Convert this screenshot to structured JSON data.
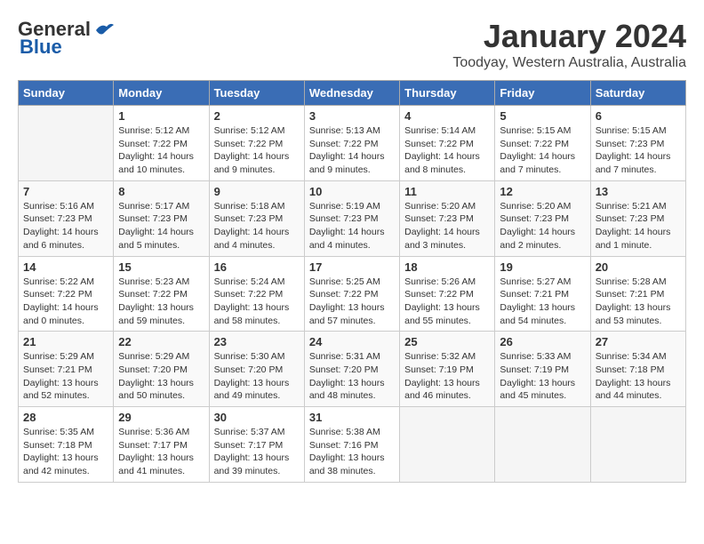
{
  "header": {
    "logo_line1": "General",
    "logo_line2": "Blue",
    "month": "January 2024",
    "location": "Toodyay, Western Australia, Australia"
  },
  "weekdays": [
    "Sunday",
    "Monday",
    "Tuesday",
    "Wednesday",
    "Thursday",
    "Friday",
    "Saturday"
  ],
  "weeks": [
    [
      {
        "day": "",
        "content": ""
      },
      {
        "day": "1",
        "content": "Sunrise: 5:12 AM\nSunset: 7:22 PM\nDaylight: 14 hours\nand 10 minutes."
      },
      {
        "day": "2",
        "content": "Sunrise: 5:12 AM\nSunset: 7:22 PM\nDaylight: 14 hours\nand 9 minutes."
      },
      {
        "day": "3",
        "content": "Sunrise: 5:13 AM\nSunset: 7:22 PM\nDaylight: 14 hours\nand 9 minutes."
      },
      {
        "day": "4",
        "content": "Sunrise: 5:14 AM\nSunset: 7:22 PM\nDaylight: 14 hours\nand 8 minutes."
      },
      {
        "day": "5",
        "content": "Sunrise: 5:15 AM\nSunset: 7:22 PM\nDaylight: 14 hours\nand 7 minutes."
      },
      {
        "day": "6",
        "content": "Sunrise: 5:15 AM\nSunset: 7:23 PM\nDaylight: 14 hours\nand 7 minutes."
      }
    ],
    [
      {
        "day": "7",
        "content": "Sunrise: 5:16 AM\nSunset: 7:23 PM\nDaylight: 14 hours\nand 6 minutes."
      },
      {
        "day": "8",
        "content": "Sunrise: 5:17 AM\nSunset: 7:23 PM\nDaylight: 14 hours\nand 5 minutes."
      },
      {
        "day": "9",
        "content": "Sunrise: 5:18 AM\nSunset: 7:23 PM\nDaylight: 14 hours\nand 4 minutes."
      },
      {
        "day": "10",
        "content": "Sunrise: 5:19 AM\nSunset: 7:23 PM\nDaylight: 14 hours\nand 4 minutes."
      },
      {
        "day": "11",
        "content": "Sunrise: 5:20 AM\nSunset: 7:23 PM\nDaylight: 14 hours\nand 3 minutes."
      },
      {
        "day": "12",
        "content": "Sunrise: 5:20 AM\nSunset: 7:23 PM\nDaylight: 14 hours\nand 2 minutes."
      },
      {
        "day": "13",
        "content": "Sunrise: 5:21 AM\nSunset: 7:23 PM\nDaylight: 14 hours\nand 1 minute."
      }
    ],
    [
      {
        "day": "14",
        "content": "Sunrise: 5:22 AM\nSunset: 7:22 PM\nDaylight: 14 hours\nand 0 minutes."
      },
      {
        "day": "15",
        "content": "Sunrise: 5:23 AM\nSunset: 7:22 PM\nDaylight: 13 hours\nand 59 minutes."
      },
      {
        "day": "16",
        "content": "Sunrise: 5:24 AM\nSunset: 7:22 PM\nDaylight: 13 hours\nand 58 minutes."
      },
      {
        "day": "17",
        "content": "Sunrise: 5:25 AM\nSunset: 7:22 PM\nDaylight: 13 hours\nand 57 minutes."
      },
      {
        "day": "18",
        "content": "Sunrise: 5:26 AM\nSunset: 7:22 PM\nDaylight: 13 hours\nand 55 minutes."
      },
      {
        "day": "19",
        "content": "Sunrise: 5:27 AM\nSunset: 7:21 PM\nDaylight: 13 hours\nand 54 minutes."
      },
      {
        "day": "20",
        "content": "Sunrise: 5:28 AM\nSunset: 7:21 PM\nDaylight: 13 hours\nand 53 minutes."
      }
    ],
    [
      {
        "day": "21",
        "content": "Sunrise: 5:29 AM\nSunset: 7:21 PM\nDaylight: 13 hours\nand 52 minutes."
      },
      {
        "day": "22",
        "content": "Sunrise: 5:29 AM\nSunset: 7:20 PM\nDaylight: 13 hours\nand 50 minutes."
      },
      {
        "day": "23",
        "content": "Sunrise: 5:30 AM\nSunset: 7:20 PM\nDaylight: 13 hours\nand 49 minutes."
      },
      {
        "day": "24",
        "content": "Sunrise: 5:31 AM\nSunset: 7:20 PM\nDaylight: 13 hours\nand 48 minutes."
      },
      {
        "day": "25",
        "content": "Sunrise: 5:32 AM\nSunset: 7:19 PM\nDaylight: 13 hours\nand 46 minutes."
      },
      {
        "day": "26",
        "content": "Sunrise: 5:33 AM\nSunset: 7:19 PM\nDaylight: 13 hours\nand 45 minutes."
      },
      {
        "day": "27",
        "content": "Sunrise: 5:34 AM\nSunset: 7:18 PM\nDaylight: 13 hours\nand 44 minutes."
      }
    ],
    [
      {
        "day": "28",
        "content": "Sunrise: 5:35 AM\nSunset: 7:18 PM\nDaylight: 13 hours\nand 42 minutes."
      },
      {
        "day": "29",
        "content": "Sunrise: 5:36 AM\nSunset: 7:17 PM\nDaylight: 13 hours\nand 41 minutes."
      },
      {
        "day": "30",
        "content": "Sunrise: 5:37 AM\nSunset: 7:17 PM\nDaylight: 13 hours\nand 39 minutes."
      },
      {
        "day": "31",
        "content": "Sunrise: 5:38 AM\nSunset: 7:16 PM\nDaylight: 13 hours\nand 38 minutes."
      },
      {
        "day": "",
        "content": ""
      },
      {
        "day": "",
        "content": ""
      },
      {
        "day": "",
        "content": ""
      }
    ]
  ]
}
